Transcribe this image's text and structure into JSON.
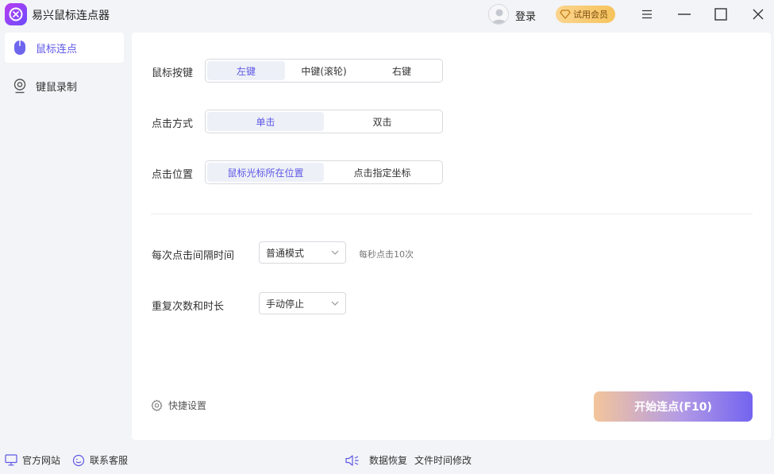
{
  "app": {
    "title": "易兴鼠标连点器",
    "login_label": "登录",
    "vip_label": "试用会员",
    "accent_color": "#5e57e6"
  },
  "sidebar": {
    "items": [
      {
        "label": "鼠标连点",
        "icon": "mouse-icon",
        "active": true
      },
      {
        "label": "键鼠录制",
        "icon": "record-icon",
        "active": false
      }
    ]
  },
  "settings": {
    "mouse_button": {
      "label": "鼠标按键",
      "options": [
        "左键",
        "中键(滚轮)",
        "右键"
      ],
      "selected": "左键"
    },
    "click_mode": {
      "label": "点击方式",
      "options": [
        "单击",
        "双击"
      ],
      "selected": "单击"
    },
    "click_position": {
      "label": "点击位置",
      "options": [
        "鼠标光标所在位置",
        "点击指定坐标"
      ],
      "selected": "鼠标光标所在位置"
    },
    "interval": {
      "label": "每次点击间隔时间",
      "value": "普通模式",
      "hint": "每秒点击10次"
    },
    "repeat": {
      "label": "重复次数和时长",
      "value": "手动停止"
    }
  },
  "actions": {
    "shortcut_label": "快捷设置",
    "start_label": "开始连点(F10)"
  },
  "footer": {
    "website": "官方网站",
    "support": "联系客服",
    "data_recovery": "数据恢复",
    "file_time": "文件时间修改"
  }
}
